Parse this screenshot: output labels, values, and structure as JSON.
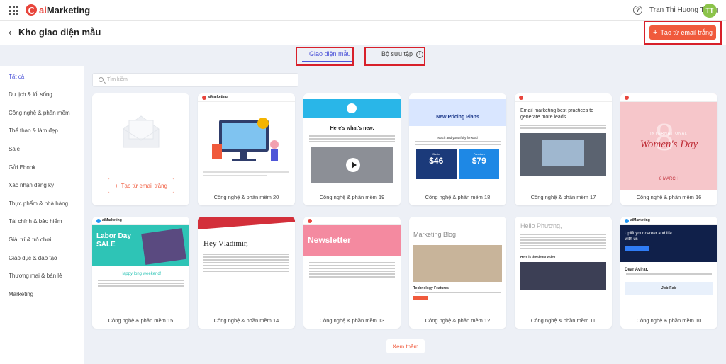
{
  "app": {
    "brand_prefix": "ai",
    "brand_suffix": "Marketing",
    "user_name": "Tran Thi Huong Trang",
    "avatar_initials": "TT"
  },
  "header": {
    "title": "Kho giao diện mẫu",
    "create_blank_label": "Tạo từ email trắng",
    "back_icon": "chevron-left-icon"
  },
  "tabs": [
    {
      "label": "Giao diện mẫu",
      "active": true
    },
    {
      "label": "Bộ sưu tập",
      "active": false
    }
  ],
  "sidebar": {
    "items": [
      {
        "label": "Tất cả",
        "active": true
      },
      {
        "label": "Du lịch & lối sống"
      },
      {
        "label": "Công nghệ & phần mềm"
      },
      {
        "label": "Thể thao & làm đẹp"
      },
      {
        "label": "Sale"
      },
      {
        "label": "Gửi Ebook"
      },
      {
        "label": "Xác nhận đăng ký"
      },
      {
        "label": "Thực phẩm & nhà hàng"
      },
      {
        "label": "Tài chính & bảo hiểm"
      },
      {
        "label": "Giải trí & trò chơi"
      },
      {
        "label": "Giáo dục & đào tạo"
      },
      {
        "label": "Thương mại & bán lẻ"
      },
      {
        "label": "Marketing"
      }
    ]
  },
  "search": {
    "placeholder": "Tìm kiếm"
  },
  "blank_card": {
    "label": "Tạo từ email trắng"
  },
  "templates": [
    {
      "caption": "Công nghệ & phần mềm 20",
      "headline": "aiMarketing"
    },
    {
      "caption": "Công nghệ & phần mềm 19",
      "headline": "Here's what's new."
    },
    {
      "caption": "Công nghệ & phần mềm 18",
      "headline": "New Pricing Plans",
      "sub": "Mach and youthfully forward",
      "price1": "$46",
      "price2": "$79",
      "plan1": "Basic",
      "plan2": "Premium"
    },
    {
      "caption": "Công nghệ & phần mềm 17",
      "headline": "Email marketing best practices to generate more leads."
    },
    {
      "caption": "Công nghệ & phần mềm 16",
      "headline_top": "INTERNATIONAL",
      "headline": "Women's Day",
      "sub": "8 MARCH"
    },
    {
      "caption": "Công nghệ & phần mềm 15",
      "headline": "Labor Day SALE",
      "sub": "Happy long weekend!"
    },
    {
      "caption": "Công nghệ & phần mềm 14",
      "headline": "Hey Vladimir,"
    },
    {
      "caption": "Công nghệ & phần mềm 13",
      "headline": "Newsletter"
    },
    {
      "caption": "Công nghệ & phần mềm 12",
      "headline": "Marketing Blog",
      "sub": "Technology Features"
    },
    {
      "caption": "Công nghệ & phần mềm 11",
      "headline": "Hello Phương,",
      "sub": "Here is the demo video"
    },
    {
      "caption": "Công nghệ & phần mềm 10",
      "headline": "Uplift your career and life with us",
      "sub": "Dear Avirar,",
      "footer": "Job Fair"
    }
  ],
  "load_more": "Xem thêm",
  "colors": {
    "accent": "#4f56d8",
    "brand": "#f05a3c",
    "highlight": "#d8202a",
    "bg": "#edf0f6"
  }
}
